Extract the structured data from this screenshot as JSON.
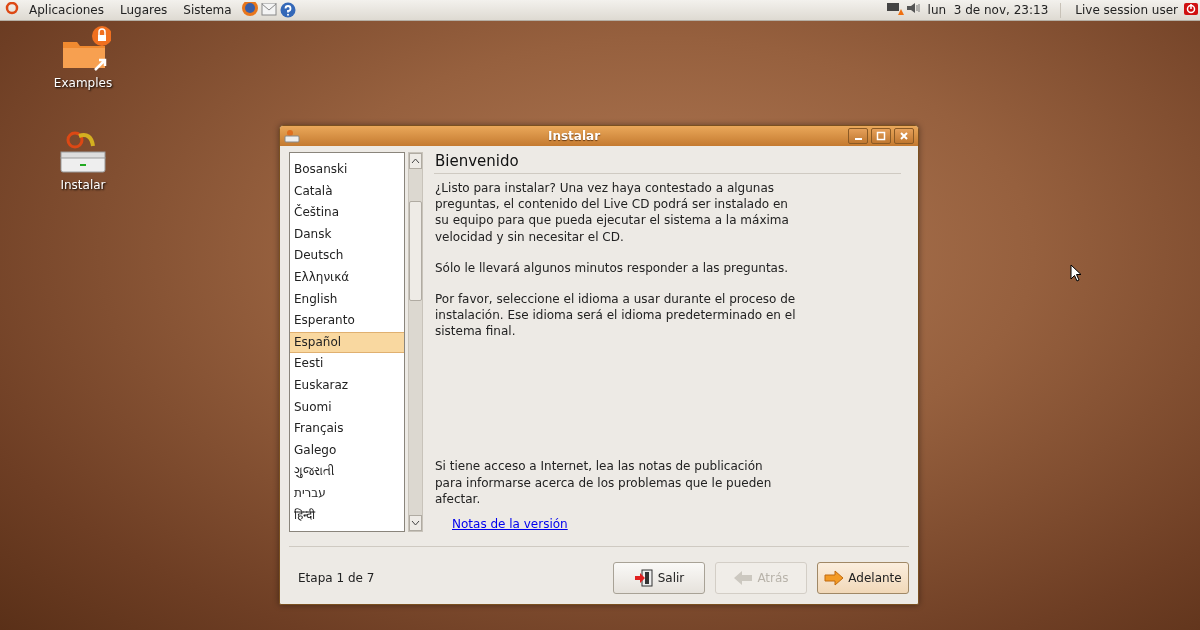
{
  "top_panel": {
    "menus": [
      "Aplicaciones",
      "Lugares",
      "Sistema"
    ],
    "clock": "lun  3 de nov, 23:13",
    "user": "Live session user"
  },
  "desktop_icons": [
    {
      "label": "Examples",
      "kind": "folder"
    },
    {
      "label": "Instalar",
      "kind": "installer"
    }
  ],
  "window": {
    "title": "Instalar",
    "languages": [
      {
        "label": "Bosanski",
        "selected": false
      },
      {
        "label": "Català",
        "selected": false
      },
      {
        "label": "Čeština",
        "selected": false
      },
      {
        "label": "Dansk",
        "selected": false
      },
      {
        "label": "Deutsch",
        "selected": false
      },
      {
        "label": "Ελληνικά",
        "selected": false
      },
      {
        "label": "English",
        "selected": false
      },
      {
        "label": "Esperanto",
        "selected": false
      },
      {
        "label": "Español",
        "selected": true
      },
      {
        "label": "Eesti",
        "selected": false
      },
      {
        "label": "Euskaraz",
        "selected": false
      },
      {
        "label": "Suomi",
        "selected": false
      },
      {
        "label": "Français",
        "selected": false
      },
      {
        "label": "Galego",
        "selected": false
      },
      {
        "label": "ગુજરાતી",
        "selected": false
      },
      {
        "label": "עברית",
        "selected": false
      },
      {
        "label": "हिन्दी",
        "selected": false
      }
    ],
    "heading": "Bienvenido",
    "paragraphs": [
      "¿Listo para instalar? Una vez haya contestado a algunas preguntas, el contenido del Live CD podrá ser instalado en su equipo para que pueda ejecutar el sistema a la máxima velocidad y sin necesitar el CD.",
      "Sólo le llevará algunos minutos responder a las preguntas.",
      "Por favor, seleccione el idioma a usar durante el proceso de instalación. Ese idioma será el idioma predeterminado en el sistema final."
    ],
    "notes_text": "Si tiene acceso a Internet, lea las notas de publicación para informarse acerca de los problemas que le pueden afectar.",
    "notes_link": "Notas de la versión",
    "step": "Etapa 1 de 7",
    "buttons": [
      {
        "label": "Salir",
        "kind": "quit",
        "disabled": false,
        "focused": false
      },
      {
        "label": "Atrás",
        "kind": "back",
        "disabled": true,
        "focused": false
      },
      {
        "label": "Adelante",
        "kind": "forward",
        "disabled": false,
        "focused": true
      }
    ]
  }
}
